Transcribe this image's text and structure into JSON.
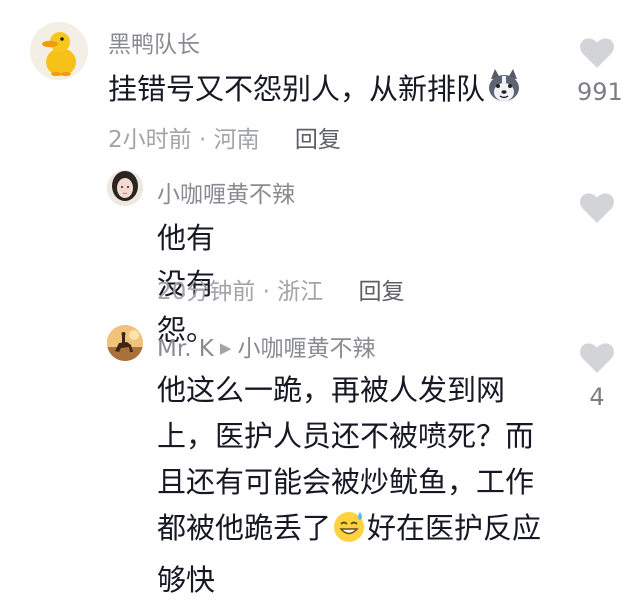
{
  "comments": [
    {
      "username": "黑鸭队长",
      "text_before_emoji": "挂错号又不怨别人，从新排队",
      "emoji": "husky-dog-emoji",
      "time": "2小时前",
      "location": "河南",
      "reply_label": "回复",
      "likes": "991"
    },
    {
      "username": "小咖喱黄不辣",
      "text": "他有没有怨。",
      "time": "20分钟前",
      "location": "浙江",
      "reply_label": "回复",
      "likes": ""
    },
    {
      "username": "Mr. K",
      "reply_to": "小咖喱黄不辣",
      "lines": [
        "他这么一跪，再被人发到网",
        "上，医护人员还不被喷死？而",
        "且还有可能会被炒鱿鱼，工作"
      ],
      "line4_before_emoji": "都被他跪丢了",
      "emoji": "sweat-smile-emoji",
      "line4_after_emoji": "好在医护反应",
      "line5": "够快",
      "likes": "4"
    }
  ],
  "colors": {
    "username": "#8a8b91",
    "text": "#161823",
    "meta": "#a3a4a8",
    "reply": "#5f6066",
    "heart": "#d3d4d8"
  }
}
